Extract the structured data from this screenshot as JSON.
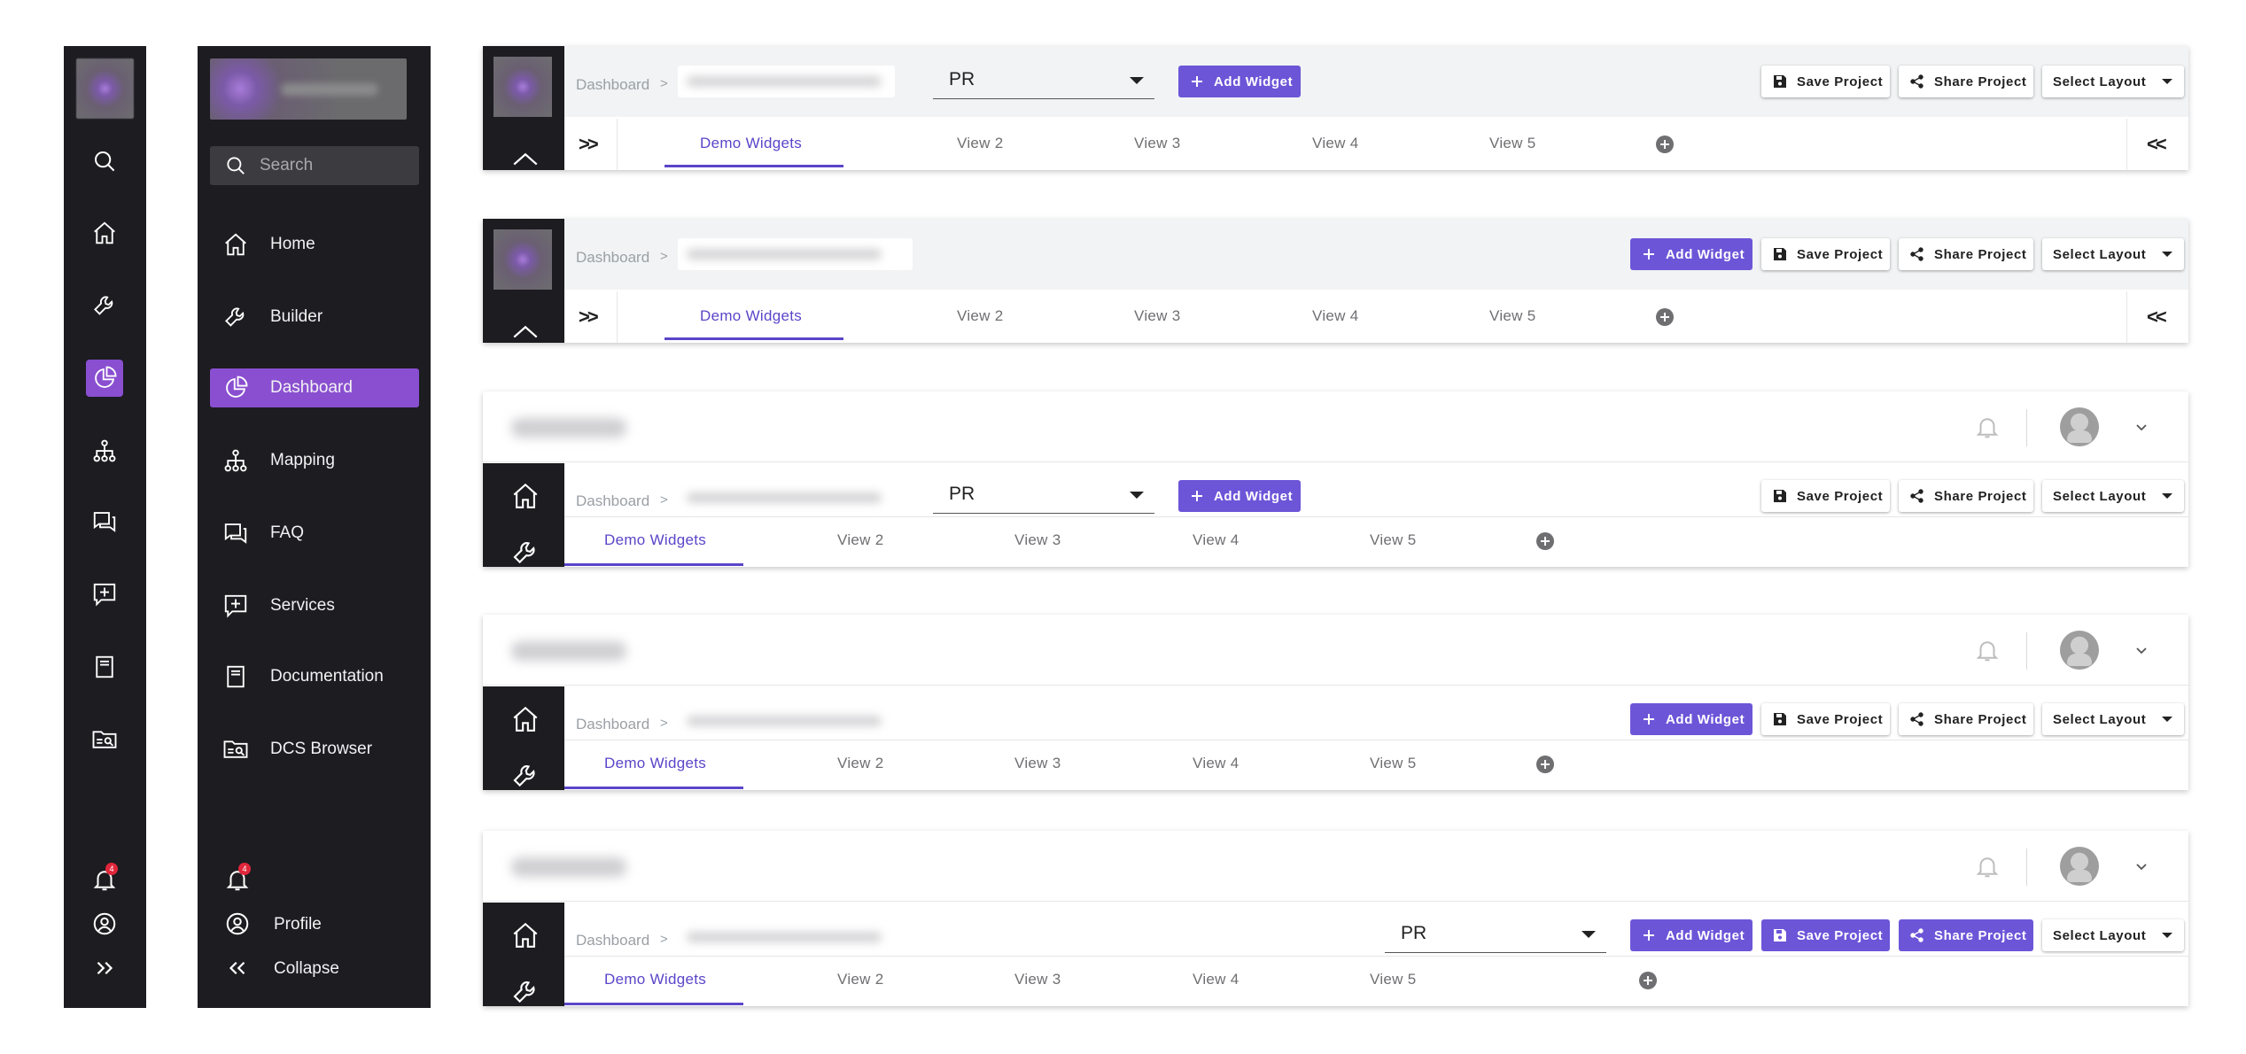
{
  "sidebar_collapsed": {
    "badge_count": "4",
    "items": [
      {
        "icon": "search-icon"
      },
      {
        "icon": "home-icon"
      },
      {
        "icon": "wrench-icon"
      },
      {
        "icon": "dashboard-icon",
        "active": true
      },
      {
        "icon": "mapping-icon"
      },
      {
        "icon": "faq-icon"
      },
      {
        "icon": "services-icon"
      },
      {
        "icon": "documentation-icon"
      },
      {
        "icon": "dcs-browser-icon"
      }
    ]
  },
  "sidebar_expanded": {
    "search_placeholder": "Search",
    "items": [
      {
        "label": "Home",
        "icon": "home-icon"
      },
      {
        "label": "Builder",
        "icon": "wrench-icon"
      },
      {
        "label": "Dashboard",
        "icon": "dashboard-icon",
        "active": true
      },
      {
        "label": "Mapping",
        "icon": "mapping-icon"
      },
      {
        "label": "FAQ",
        "icon": "faq-icon"
      },
      {
        "label": "Services",
        "icon": "services-icon"
      },
      {
        "label": "Documentation",
        "icon": "documentation-icon"
      },
      {
        "label": "DCS Browser",
        "icon": "dcs-browser-icon"
      }
    ],
    "badge_count": "4",
    "profile_label": "Profile",
    "collapse_label": "Collapse",
    "accent": "#8a4fd0"
  },
  "header": {
    "breadcrumb_root": "Dashboard",
    "breadcrumb_sep": ">",
    "select_value": "PR",
    "add_widget": "Add Widget",
    "save_project": "Save Project",
    "share_project": "Share Project",
    "select_layout": "Select Layout",
    "tabs": [
      "Demo Widgets",
      "View 2",
      "View 3",
      "View 4",
      "View 5"
    ],
    "expand_glyph": ">>",
    "collapse_glyph": "<<",
    "button_color": "#6d55d8",
    "tab_active_color": "#5b45c9"
  }
}
